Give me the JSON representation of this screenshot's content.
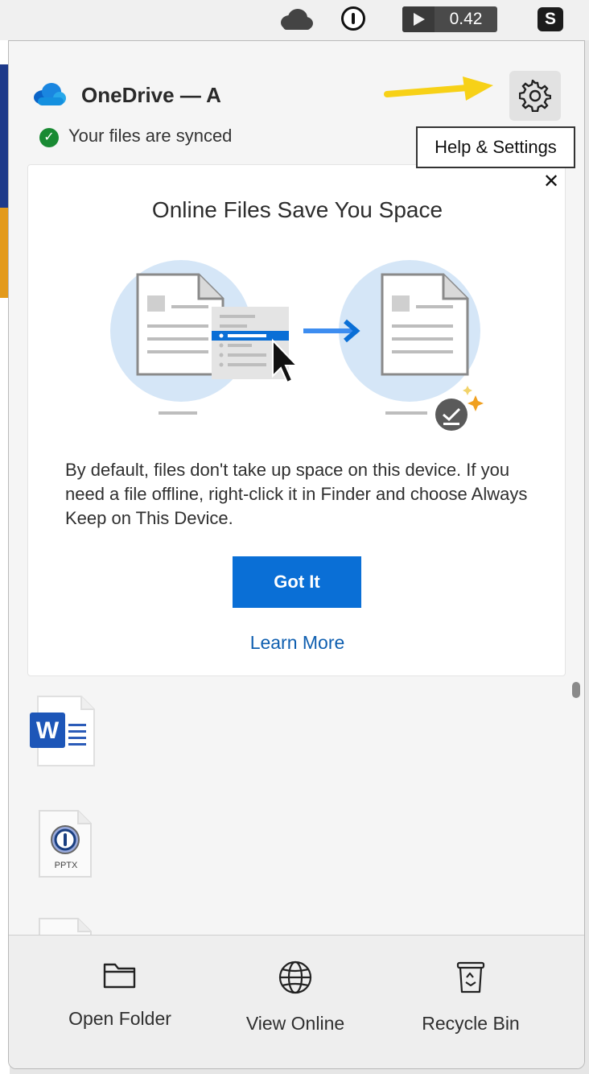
{
  "menubar": {
    "timer_value": "0.42",
    "skype_letter": "S"
  },
  "header": {
    "title": "OneDrive — A",
    "status": "Your files are synced",
    "tooltip": "Help & Settings"
  },
  "card": {
    "title": "Online Files Save You Space",
    "body": "By default, files don't take up space on this device. If you need a file offline, right-click it in Finder and choose Always Keep on This Device.",
    "primary_button": "Got It",
    "link": "Learn More"
  },
  "files": [
    {
      "type": "word",
      "icon": "word-file-icon"
    },
    {
      "type": "pptx",
      "label": "PPTX",
      "icon": "pptx-file-icon"
    },
    {
      "type": "document",
      "icon": "document-file-icon"
    }
  ],
  "footer": {
    "items": [
      {
        "label": "Open Folder",
        "icon": "folder-icon"
      },
      {
        "label": "View Online",
        "icon": "globe-icon"
      },
      {
        "label": "Recycle Bin",
        "icon": "recycle-bin-icon"
      }
    ]
  },
  "colors": {
    "accent": "#0a6fd6",
    "link": "#0f5fb0",
    "success": "#198a33",
    "annotation_arrow": "#f7d117"
  }
}
